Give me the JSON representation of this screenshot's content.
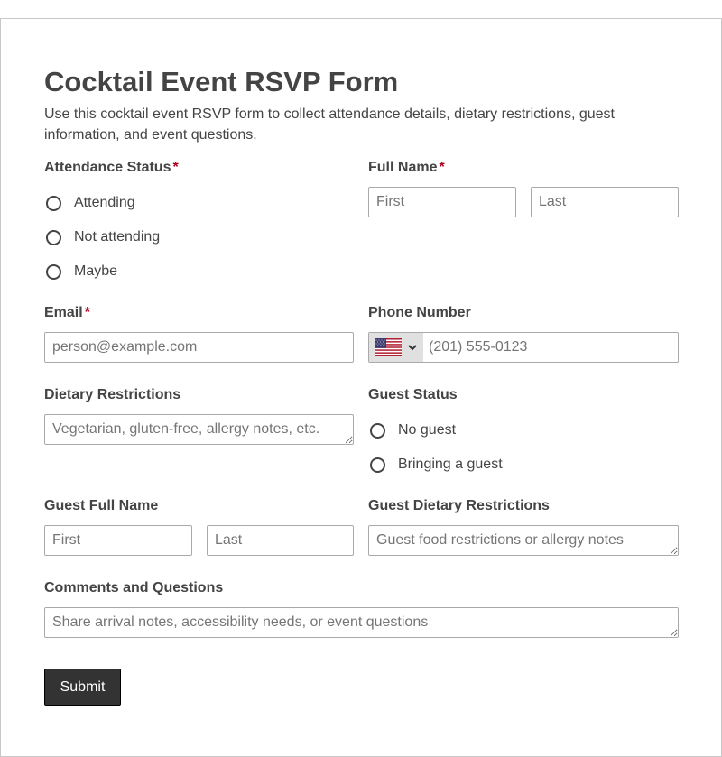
{
  "form": {
    "title": "Cocktail Event RSVP Form",
    "description": "Use this cocktail event RSVP form to collect attendance details, dietary restrictions, guest information, and event questions.",
    "required_marker": "*"
  },
  "attendance": {
    "label": "Attendance Status",
    "options": [
      "Attending",
      "Not attending",
      "Maybe"
    ]
  },
  "full_name": {
    "label": "Full Name",
    "first_placeholder": "First",
    "last_placeholder": "Last"
  },
  "email": {
    "label": "Email",
    "placeholder": "person@example.com"
  },
  "phone": {
    "label": "Phone Number",
    "placeholder": "(201) 555-0123",
    "country_flag_icon": "us-flag-icon"
  },
  "dietary": {
    "label": "Dietary Restrictions",
    "placeholder": "Vegetarian, gluten-free, allergy notes, etc."
  },
  "guest_status": {
    "label": "Guest Status",
    "options": [
      "No guest",
      "Bringing a guest"
    ]
  },
  "guest_name": {
    "label": "Guest Full Name",
    "first_placeholder": "First",
    "last_placeholder": "Last"
  },
  "guest_dietary": {
    "label": "Guest Dietary Restrictions",
    "placeholder": "Guest food restrictions or allergy notes"
  },
  "comments": {
    "label": "Comments and Questions",
    "placeholder": "Share arrival notes, accessibility needs, or event questions"
  },
  "submit": {
    "label": "Submit"
  },
  "colors": {
    "required": "#b3001b",
    "text": "#444444",
    "button_bg": "#333333",
    "border": "#aaaaaa"
  }
}
